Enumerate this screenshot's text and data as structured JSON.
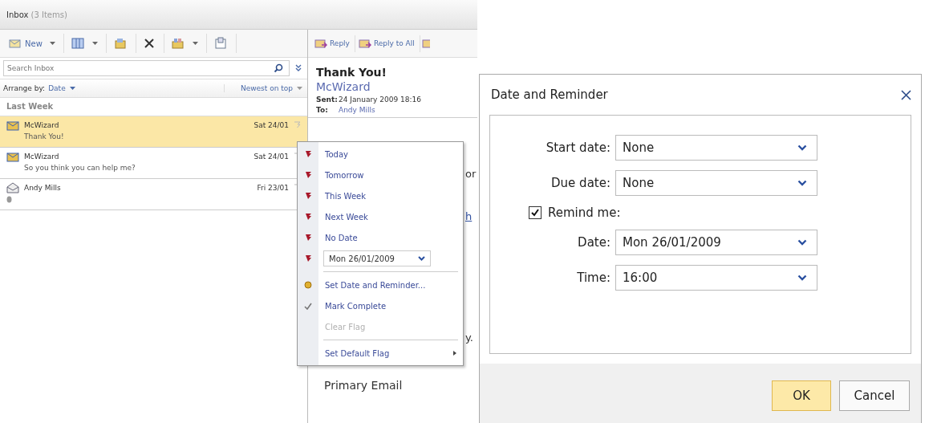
{
  "inbox": {
    "title": "Inbox",
    "count": "(3 Items)",
    "toolbar": [
      {
        "kind": "new",
        "label": "New",
        "dropdown": true
      },
      {
        "kind": "view",
        "dropdown": true
      },
      {
        "kind": "move",
        "dropdown": false
      },
      {
        "kind": "delete",
        "dropdown": false
      },
      {
        "kind": "categorize",
        "dropdown": true
      },
      {
        "kind": "print",
        "dropdown": false
      }
    ],
    "search": {
      "placeholder": "Search Inbox"
    },
    "arrange": {
      "label": "Arrange by:",
      "value": "Date",
      "order": "Newest on top"
    },
    "group": "Last Week",
    "messages": [
      {
        "sender": "McWizard",
        "subject": "Thank You!",
        "date": "Sat 24/01",
        "selected": true,
        "read": false,
        "attachment": false
      },
      {
        "sender": "McWizard",
        "subject": "So you think you can help me?",
        "date": "Sat 24/01",
        "selected": false,
        "read": false,
        "attachment": false
      },
      {
        "sender": "Andy Mills",
        "date": "Fri 23/01",
        "selected": false,
        "read": true,
        "attachment": true
      }
    ]
  },
  "reading": {
    "actions": [
      "Reply",
      "Reply to All"
    ],
    "subject": "Thank You!",
    "sender": "McWizard",
    "sent_label": "Sent:",
    "sent": "24 January 2009 18:16",
    "to_label": "To:",
    "to": "Andy Mills",
    "fragments": [
      "or",
      "h",
      "y."
    ],
    "footer": "Primary Email"
  },
  "flag_menu": [
    {
      "kind": "flag",
      "label": "Today",
      "disabled": false
    },
    {
      "kind": "flag",
      "label": "Tomorrow",
      "disabled": false
    },
    {
      "kind": "flag",
      "label": "This Week",
      "disabled": false
    },
    {
      "kind": "flag",
      "label": "Next Week",
      "disabled": false
    },
    {
      "kind": "flag",
      "label": "No Date",
      "disabled": false
    },
    {
      "kind": "date",
      "label": "Mon 26/01/2009",
      "disabled": false
    },
    {
      "kind": "reminder",
      "label": "Set Date and Reminder...",
      "disabled": false
    },
    {
      "kind": "complete",
      "label": "Mark Complete",
      "disabled": false
    },
    {
      "kind": "plain",
      "label": "Clear Flag",
      "disabled": true
    },
    {
      "kind": "submenu",
      "label": "Set Default Flag",
      "disabled": false
    }
  ],
  "dialog": {
    "title": "Date and Reminder",
    "dates": [
      {
        "label": "Start date:",
        "value": "None"
      },
      {
        "label": "Due date:",
        "value": "None"
      }
    ],
    "remind": {
      "label": "Remind me:",
      "checked": true
    },
    "reminder_fields": [
      {
        "label": "Date:",
        "value": "Mon 26/01/2009"
      },
      {
        "label": "Time:",
        "value": "16:00"
      }
    ],
    "buttons": [
      {
        "label": "OK",
        "default": true
      },
      {
        "label": "Cancel",
        "default": false
      }
    ]
  }
}
